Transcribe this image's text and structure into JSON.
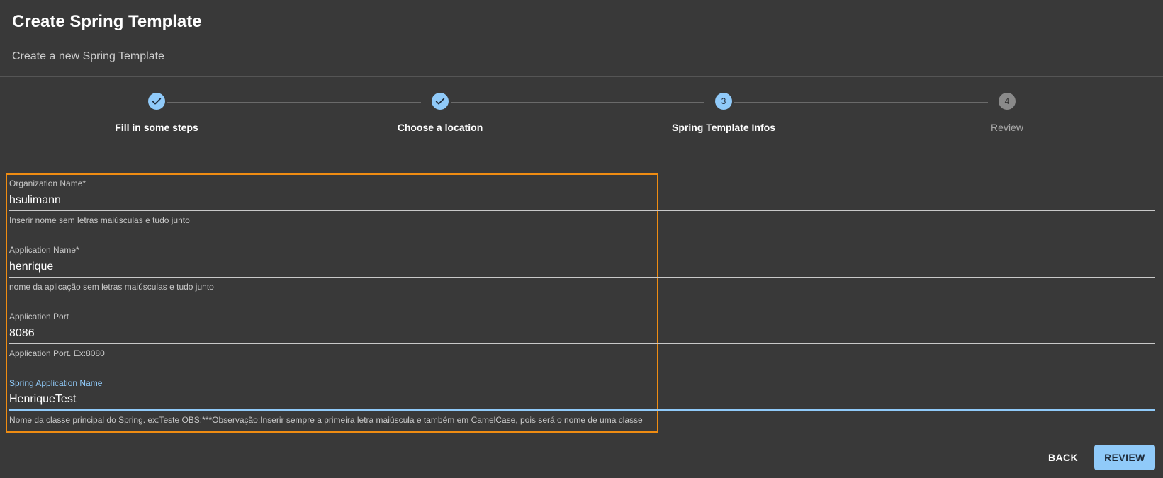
{
  "header": {
    "title": "Create Spring Template",
    "subtitle": "Create a new Spring Template"
  },
  "stepper": {
    "steps": [
      {
        "label": "Fill in some steps",
        "status": "completed",
        "icon": "check-icon"
      },
      {
        "label": "Choose a location",
        "status": "completed",
        "icon": "check-icon"
      },
      {
        "label": "Spring Template Infos",
        "status": "active",
        "number": "3"
      },
      {
        "label": "Review",
        "status": "pending",
        "number": "4"
      }
    ]
  },
  "form": {
    "fields": [
      {
        "label": "Organization Name*",
        "value": "hsulimann",
        "helper": "Inserir nome sem letras maiúsculas e tudo junto"
      },
      {
        "label": "Application Name*",
        "value": "henrique",
        "helper": "nome da aplicação sem letras maiúsculas e tudo junto"
      },
      {
        "label": "Application Port",
        "value": "8086",
        "helper": "Application Port. Ex:8080"
      },
      {
        "label": "Spring Application Name",
        "value": "HenriqueTest",
        "helper": "Nome da classe principal do Spring. ex:Teste OBS:***Observação:Inserir sempre a primeira letra maiúscula e também em CamelCase, pois será o nome de uma classe",
        "focused": true
      }
    ]
  },
  "actions": {
    "back_label": "BACK",
    "review_label": "REVIEW"
  },
  "colors": {
    "background": "#393939",
    "accent": "#90caf9",
    "highlight_outline": "#ef8c12"
  }
}
